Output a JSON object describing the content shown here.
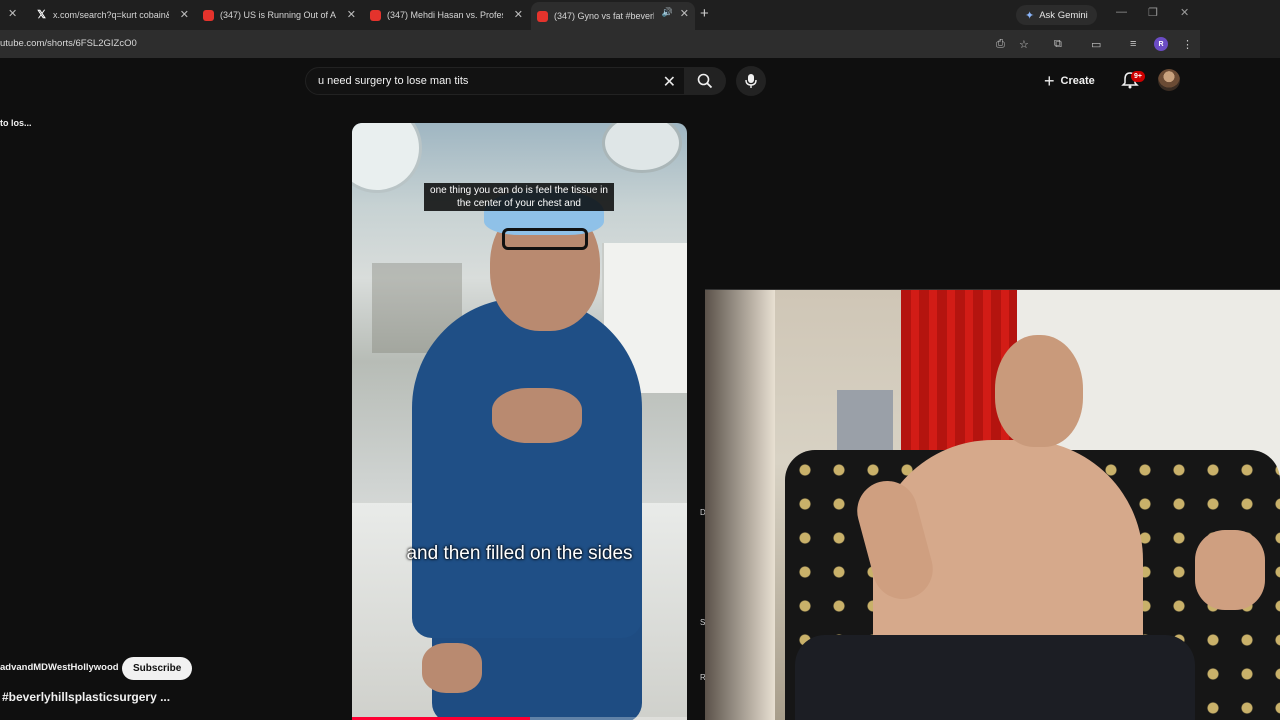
{
  "browser": {
    "tabs": [
      {
        "title": "x.com/search?q=kurt cobain&s",
        "icon": "x-logo-icon"
      },
      {
        "title": "(347) US is Running Out of Am",
        "icon": "youtube-icon"
      },
      {
        "title": "(347) Mehdi Hasan vs. Professo",
        "icon": "youtube-icon"
      },
      {
        "title": "(347) Gyno vs fat #beverlyh",
        "icon": "youtube-icon",
        "active": true
      }
    ],
    "new_tab": "+",
    "ask_gemini": "Ask Gemini",
    "url": "utube.com/shorts/6FSL2GIZcO0",
    "profile_initial": "R"
  },
  "youtube": {
    "search_value": "u need surgery to lose man tits",
    "create_label": "Create",
    "notification_count": "9+",
    "sidebar_title": "to los..."
  },
  "short": {
    "caption_top": "one thing you can do is feel the tissue in the center of your chest and",
    "caption_bottom": "and then filled on the sides",
    "channel": "advandMDWestHollywood",
    "subscribe_label": "Subscribe",
    "title": "#beverlyhillsplasticsurgery ...",
    "progress": 0.53
  },
  "side_letters": [
    "D",
    "S",
    "R"
  ],
  "colors": {
    "accent": "#ff0033",
    "background": "#0f0f0f",
    "badge": "#cc0000"
  }
}
